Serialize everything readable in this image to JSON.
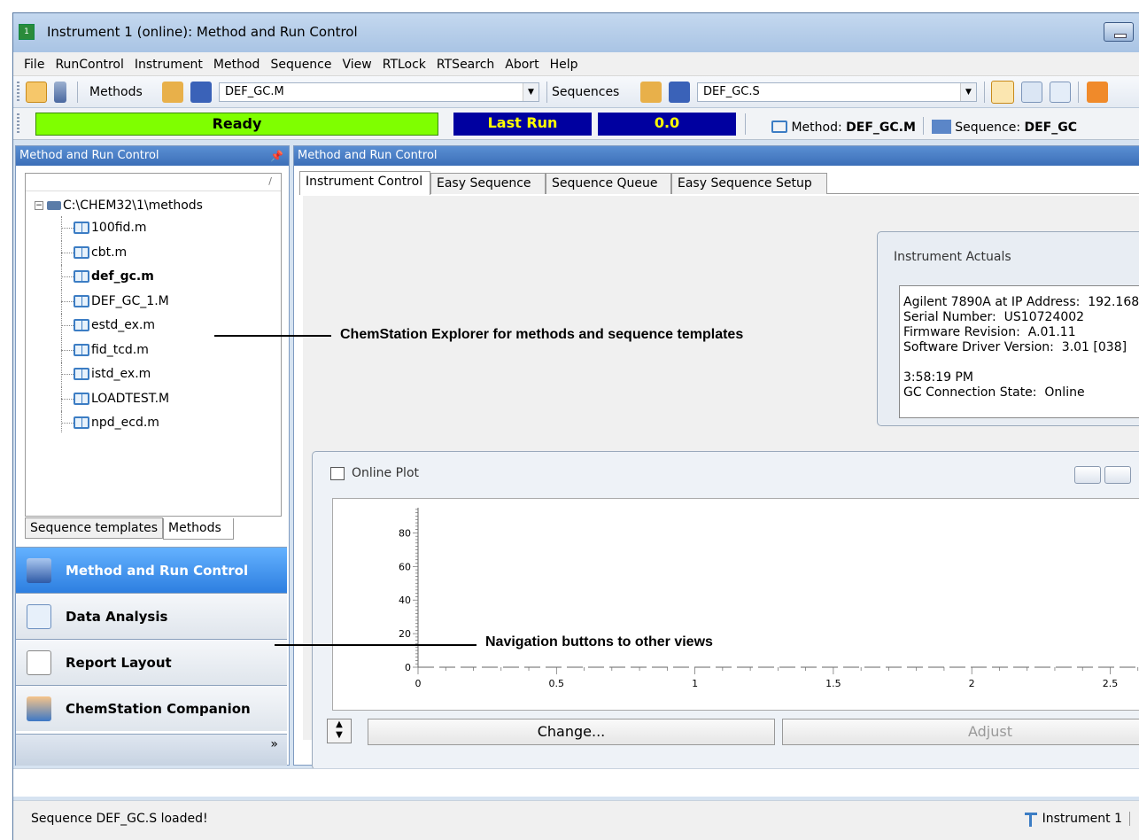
{
  "window": {
    "title": "Instrument 1 (online): Method and Run Control"
  },
  "menu": [
    "File",
    "RunControl",
    "Instrument",
    "Method",
    "Sequence",
    "View",
    "RTLock",
    "RTSearch",
    "Abort",
    "Help"
  ],
  "toolbar": {
    "methods_label": "Methods",
    "method_value": "DEF_GC.M",
    "sequences_label": "Sequences",
    "sequence_value": "DEF_GC.S"
  },
  "status": {
    "ready": "Ready",
    "last_run_label": "Last Run",
    "last_run_value": "0.0",
    "method_label": "Method:",
    "method_value": "DEF_GC.M",
    "sequence_label": "Sequence:",
    "sequence_value": "DEF_GC",
    "colors": {
      "ready": "#7fff00",
      "run_bg": "#0000a0",
      "run_text": "#ffff00"
    }
  },
  "left_pane": {
    "title": "Method and Run Control",
    "tree_root": "C:\\CHEM32\\1\\methods",
    "tree_items": [
      "100fid.m",
      "cbt.m",
      "def_gc.m",
      "DEF_GC_1.M",
      "estd_ex.m",
      "fid_tcd.m",
      "istd_ex.m",
      "LOADTEST.M",
      "npd_ecd.m"
    ],
    "tabs": [
      "Sequence templates",
      "Methods"
    ],
    "nav": [
      "Method and Run Control",
      "Data Analysis",
      "Report Layout",
      "ChemStation Companion"
    ],
    "more": "»"
  },
  "right_pane": {
    "title": "Method and Run Control",
    "tabs": [
      "Instrument Control",
      "Easy Sequence",
      "Sequence Queue",
      "Easy Sequence Setup"
    ],
    "actuals": {
      "title": "Instrument Actuals",
      "lines": [
        "Agilent 7890A at IP Address:  192.168.",
        "Serial Number:  US10724002",
        "Firmware Revision:  A.01.11",
        "Software Driver Version:  3.01 [038]",
        "",
        "3:58:19 PM",
        "GC Connection State:  Online"
      ]
    },
    "plot": {
      "title": "Online Plot",
      "change": "Change...",
      "adjust": "Adjust"
    }
  },
  "chart_data": {
    "type": "line",
    "series": [],
    "xticks": [
      "0",
      "0.5",
      "1",
      "1.5",
      "2",
      "2.5"
    ],
    "yticks": [
      "0",
      "20",
      "40",
      "60",
      "80"
    ],
    "xlim": [
      0,
      2.7
    ],
    "ylim": [
      0,
      95
    ]
  },
  "statusbar": {
    "message": "Sequence DEF_GC.S loaded!",
    "instrument": "Instrument 1"
  },
  "annotations": {
    "explorer": "ChemStation Explorer for methods and sequence templates",
    "nav": "Navigation buttons to other views"
  }
}
